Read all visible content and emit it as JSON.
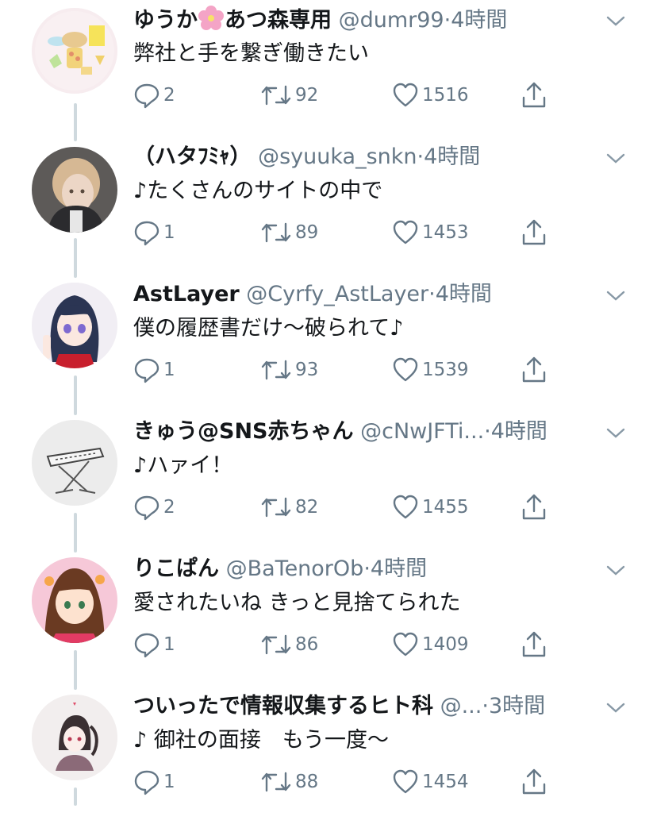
{
  "colors": {
    "text": "#14171a",
    "muted": "#657786",
    "thread_line": "#cfd9de"
  },
  "tweets": [
    {
      "name": "ゆうか",
      "name_suffix": "あつ森専用",
      "has_flower": true,
      "handle": "@dumr99",
      "dot": "·",
      "time": "4時間",
      "text": "弊社と手を繋ぎ働きたい",
      "replies": "2",
      "retweets": "92",
      "likes": "1516"
    },
    {
      "name": "（ハタﾌﾐｬ）",
      "name_suffix": "",
      "has_flower": false,
      "handle": "@syuuka_snkn",
      "dot": "·",
      "time": "4時間",
      "text": "♪たくさんのサイトの中で",
      "replies": "1",
      "retweets": "89",
      "likes": "1453"
    },
    {
      "name": "AstLayer",
      "name_suffix": "",
      "has_flower": false,
      "handle": "@Cyrfy_AstLayer",
      "dot": "·",
      "time": "4時間",
      "text": "僕の履歴書だけ〜破られて♪",
      "replies": "1",
      "retweets": "93",
      "likes": "1539"
    },
    {
      "name": "きゅう@SNS赤ちゃん",
      "name_suffix": "",
      "has_flower": false,
      "handle": "@cNwJFTi...",
      "dot": "·",
      "time": "4時間",
      "text": "♪ハァイ！",
      "replies": "2",
      "retweets": "82",
      "likes": "1455"
    },
    {
      "name": "りこぱん",
      "name_suffix": "",
      "has_flower": false,
      "handle": "@BaTenorOb",
      "dot": "·",
      "time": "4時間",
      "text": "愛されたいね きっと見捨てられた",
      "replies": "1",
      "retweets": "86",
      "likes": "1409"
    },
    {
      "name": "ついったで情報収集するヒト科",
      "name_suffix": "",
      "has_flower": false,
      "handle": "@...",
      "dot": "·",
      "time": "3時間",
      "text": "♪ 御社の面接　もう一度〜",
      "replies": "1",
      "retweets": "88",
      "likes": "1454"
    }
  ],
  "icons": {
    "reply": "speech-bubble-icon",
    "retweet": "retweet-arrows-icon",
    "like": "heart-icon",
    "share": "share-upload-icon",
    "menu": "chevron-down-icon"
  }
}
